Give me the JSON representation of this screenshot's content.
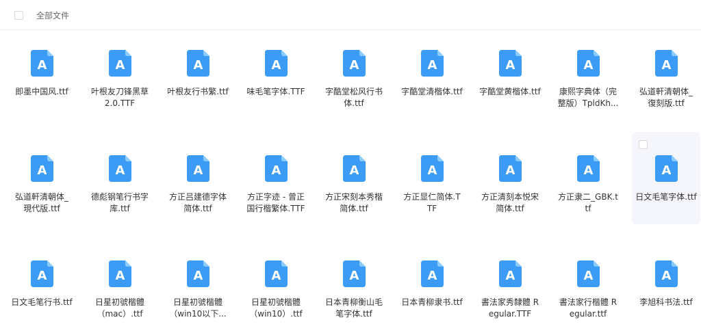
{
  "header": {
    "title": "全部文件"
  },
  "files": [
    [
      "即墨中国风.ttf"
    ],
    [
      "叶根友刀锋黑草",
      "2.0.TTF"
    ],
    [
      "叶根友行书繁.ttf"
    ],
    [
      "味毛笔字体.TTF"
    ],
    [
      "字酷堂松风行书",
      "体.ttf"
    ],
    [
      "字酷堂清楷体.ttf"
    ],
    [
      "字酷堂黄楷体.ttf"
    ],
    [
      "康熙字典体（完",
      "整版）TpldKh..."
    ],
    [
      "弘道軒清朝体_",
      "復刻版.ttf"
    ],
    [
      "弘道軒清朝体_",
      "現代版.ttf"
    ],
    [
      "德彪钢笔行书字",
      "库.ttf"
    ],
    [
      "方正吕建德字体",
      "简体.ttf"
    ],
    [
      "方正字迹 - 曾正",
      "国行楷繁体.TTF"
    ],
    [
      "方正宋刻本秀楷",
      "简体.ttf"
    ],
    [
      "方正显仁简体.T",
      "TF"
    ],
    [
      "方正清刻本悦宋",
      "简体.ttf"
    ],
    [
      "方正隶二_GBK.t",
      "tf"
    ],
    [
      "日文毛笔字体.ttf"
    ],
    [
      "日文毛笔行书.ttf"
    ],
    [
      "日星初號楷體",
      "（mac）.ttf"
    ],
    [
      "日星初號楷體",
      "（win10以下..."
    ],
    [
      "日星初號楷體",
      "（win10）.ttf"
    ],
    [
      "日本青柳衡山毛",
      "笔字体.ttf"
    ],
    [
      "日本青柳隶书.ttf"
    ],
    [
      "書法家秀隸體 R",
      "egular.TTF"
    ],
    [
      "書法家行楷體 R",
      "egular.ttf"
    ],
    [
      "李旭科书法.ttf"
    ]
  ],
  "selected_index": 17,
  "icon": {
    "name": "font-file-icon",
    "letter": "A",
    "color": "#3c9cf5",
    "fold_color": "#8ccbff"
  }
}
